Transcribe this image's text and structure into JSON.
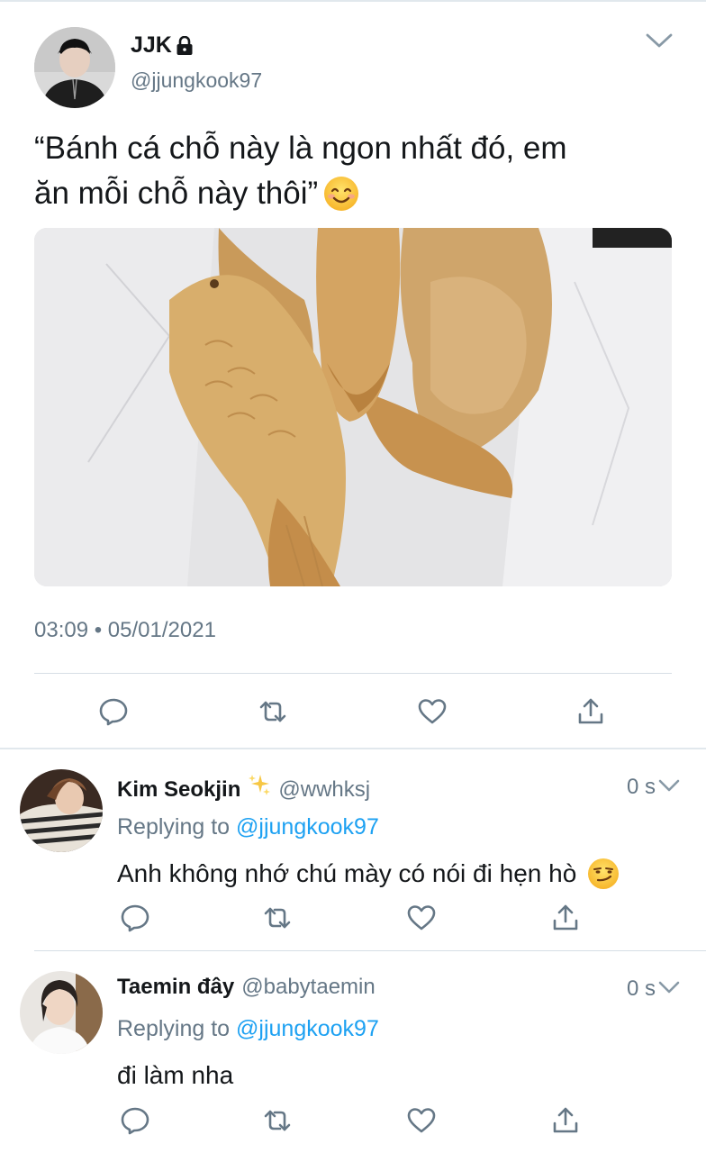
{
  "tweet": {
    "display_name": "JJK",
    "handle": "@jjungkook97",
    "text_line1": "“Bánh cá chỗ này là ngon nhất đó, em",
    "text_line2": "ăn mỗi chỗ này thôi”",
    "emoji": "smiling-face-icon",
    "timestamp": "03:09 • 05/01/2021",
    "photo": "fish-shaped pastries (bungeoppang) on white paper",
    "actions": [
      "reply-icon",
      "retweet-icon",
      "like-icon",
      "share-icon"
    ]
  },
  "replies": [
    {
      "display_name": "Kim Seokjin",
      "badge": "sparkles-icon",
      "handle": "@wwhksj",
      "time": "0 s",
      "replying_prefix": "Replying to",
      "replying_handle": "@jjungkook97",
      "text": "Anh không nhớ chú mày có nói đi hẹn hò",
      "emoji": "smirking-face-icon"
    },
    {
      "display_name": "Taemin đây",
      "handle": "@babytaemin",
      "time": "0 s",
      "replying_prefix": "Replying to",
      "replying_handle": "@jjungkook97",
      "text": "đi làm nha"
    }
  ],
  "colors": {
    "text": "#14171a",
    "secondary": "#657786",
    "link": "#1da1f2",
    "divider": "#d6dee5"
  }
}
